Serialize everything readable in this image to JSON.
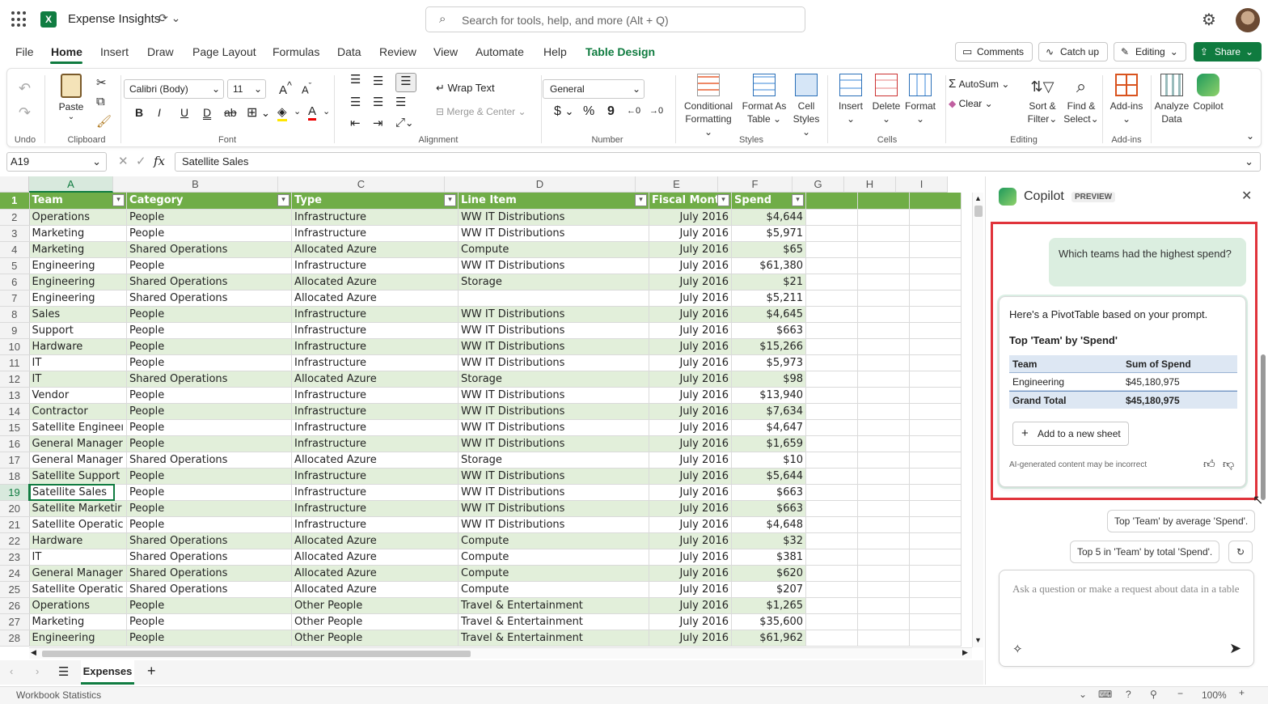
{
  "app": {
    "title": "Expense Insights",
    "search_placeholder": "Search for tools, help, and more (Alt + Q)"
  },
  "menu": {
    "items": [
      "File",
      "Home",
      "Insert",
      "Draw",
      "Page Layout",
      "Formulas",
      "Data",
      "Review",
      "View",
      "Automate",
      "Help",
      "Table Design"
    ],
    "active": "Home"
  },
  "header_buttons": {
    "comments": "Comments",
    "catch_up": "Catch up",
    "editing": "Editing",
    "share": "Share"
  },
  "ribbon": {
    "undo_group": "Undo",
    "clipboard": {
      "paste": "Paste",
      "label": "Clipboard"
    },
    "font": {
      "name": "Calibri (Body)",
      "size": "11",
      "label": "Font"
    },
    "alignment": {
      "wrap": "Wrap Text",
      "merge": "Merge & Center",
      "label": "Alignment"
    },
    "number": {
      "format": "General",
      "label": "Number"
    },
    "styles": {
      "conditional": [
        "Conditional",
        "Formatting"
      ],
      "format_table": [
        "Format As",
        "Table"
      ],
      "cell_styles": [
        "Cell",
        "Styles"
      ],
      "label": "Styles"
    },
    "cells": {
      "insert": "Insert",
      "delete": "Delete",
      "format": "Format",
      "label": "Cells"
    },
    "editing": {
      "autosum": "AutoSum",
      "clear": "Clear",
      "sort": [
        "Sort &",
        "Filter"
      ],
      "find": [
        "Find &",
        "Select"
      ],
      "label": "Editing"
    },
    "addins": {
      "addins": "Add-ins",
      "label": "Add-ins"
    },
    "analyze": [
      "Analyze",
      "Data"
    ],
    "copilot": "Copilot"
  },
  "formula_bar": {
    "name_box": "A19",
    "fx": "fx",
    "value": "Satellite Sales"
  },
  "columns": [
    "A",
    "B",
    "C",
    "D",
    "E",
    "F",
    "G",
    "H",
    "I"
  ],
  "table": {
    "headers": [
      "Team",
      "Category",
      "Type",
      "Line Item",
      "Fiscal Month",
      "Spend"
    ],
    "rows": [
      [
        "Operations",
        "People",
        "Infrastructure",
        "WW IT Distributions",
        "July 2016",
        "$4,644"
      ],
      [
        "Marketing",
        "People",
        "Infrastructure",
        "WW IT Distributions",
        "July 2016",
        "$5,971"
      ],
      [
        "Marketing",
        "Shared Operations",
        "Allocated Azure",
        "Compute",
        "July 2016",
        "$65"
      ],
      [
        "Engineering",
        "People",
        "Infrastructure",
        "WW IT Distributions",
        "July 2016",
        "$61,380"
      ],
      [
        "Engineering",
        "Shared Operations",
        "Allocated Azure",
        "Storage",
        "July 2016",
        "$21"
      ],
      [
        "Engineering",
        "Shared Operations",
        "Allocated Azure",
        "",
        "July 2016",
        "$5,211"
      ],
      [
        "Sales",
        "People",
        "Infrastructure",
        "WW IT Distributions",
        "July 2016",
        "$4,645"
      ],
      [
        "Support",
        "People",
        "Infrastructure",
        "WW IT Distributions",
        "July 2016",
        "$663"
      ],
      [
        "Hardware",
        "People",
        "Infrastructure",
        "WW IT Distributions",
        "July 2016",
        "$15,266"
      ],
      [
        "IT",
        "People",
        "Infrastructure",
        "WW IT Distributions",
        "July 2016",
        "$5,973"
      ],
      [
        "IT",
        "Shared Operations",
        "Allocated Azure",
        "Storage",
        "July 2016",
        "$98"
      ],
      [
        "Vendor",
        "People",
        "Infrastructure",
        "WW IT Distributions",
        "July 2016",
        "$13,940"
      ],
      [
        "Contractor",
        "People",
        "Infrastructure",
        "WW IT Distributions",
        "July 2016",
        "$7,634"
      ],
      [
        "Satellite Engineeı",
        "People",
        "Infrastructure",
        "WW IT Distributions",
        "July 2016",
        "$4,647"
      ],
      [
        "General Manager",
        "People",
        "Infrastructure",
        "WW IT Distributions",
        "July 2016",
        "$1,659"
      ],
      [
        "General Manager",
        "Shared Operations",
        "Allocated Azure",
        "Storage",
        "July 2016",
        "$10"
      ],
      [
        "Satellite Support",
        "People",
        "Infrastructure",
        "WW IT Distributions",
        "July 2016",
        "$5,644"
      ],
      [
        "Satellite Sales",
        "People",
        "Infrastructure",
        "WW IT Distributions",
        "July 2016",
        "$663"
      ],
      [
        "Satellite Marketir",
        "People",
        "Infrastructure",
        "WW IT Distributions",
        "July 2016",
        "$663"
      ],
      [
        "Satellite Operatic",
        "People",
        "Infrastructure",
        "WW IT Distributions",
        "July 2016",
        "$4,648"
      ],
      [
        "Hardware",
        "Shared Operations",
        "Allocated Azure",
        "Compute",
        "July 2016",
        "$32"
      ],
      [
        "IT",
        "Shared Operations",
        "Allocated Azure",
        "Compute",
        "July 2016",
        "$381"
      ],
      [
        "General Manager",
        "Shared Operations",
        "Allocated Azure",
        "Compute",
        "July 2016",
        "$620"
      ],
      [
        "Satellite Operatic",
        "Shared Operations",
        "Allocated Azure",
        "Compute",
        "July 2016",
        "$207"
      ],
      [
        "Operations",
        "People",
        "Other People",
        "Travel & Entertainment",
        "July 2016",
        "$1,265"
      ],
      [
        "Marketing",
        "People",
        "Other People",
        "Travel & Entertainment",
        "July 2016",
        "$35,600"
      ],
      [
        "Engineering",
        "People",
        "Other People",
        "Travel & Entertainment",
        "July 2016",
        "$61,962"
      ]
    ]
  },
  "sheet_tabs": {
    "active": "Expenses"
  },
  "status": {
    "left": "Workbook Statistics",
    "zoom": "100%"
  },
  "copilot": {
    "title": "Copilot",
    "badge": "PREVIEW",
    "user_message": "Which teams had the highest spend?",
    "response_intro": "Here's a PivotTable based on your prompt.",
    "pivot_title": "Top 'Team' by 'Spend'",
    "pivot_headers": [
      "Team",
      "Sum of Spend"
    ],
    "pivot_rows": [
      [
        "Engineering",
        "$45,180,975"
      ]
    ],
    "pivot_total": [
      "Grand Total",
      "$45,180,975"
    ],
    "add_button": "Add to a new sheet",
    "disclaimer": "AI-generated content may be incorrect",
    "suggestions": [
      "Top 'Team' by average 'Spend'.",
      "Top 5 in 'Team' by total 'Spend'."
    ],
    "input_placeholder": "Ask a question or make a request about data in a table"
  },
  "colors": {
    "accent": "#0f7b3f",
    "table_header": "#70ad47",
    "band": "#e2efda",
    "highlight_border": "#e0333b",
    "share": "#0f7b3f"
  }
}
